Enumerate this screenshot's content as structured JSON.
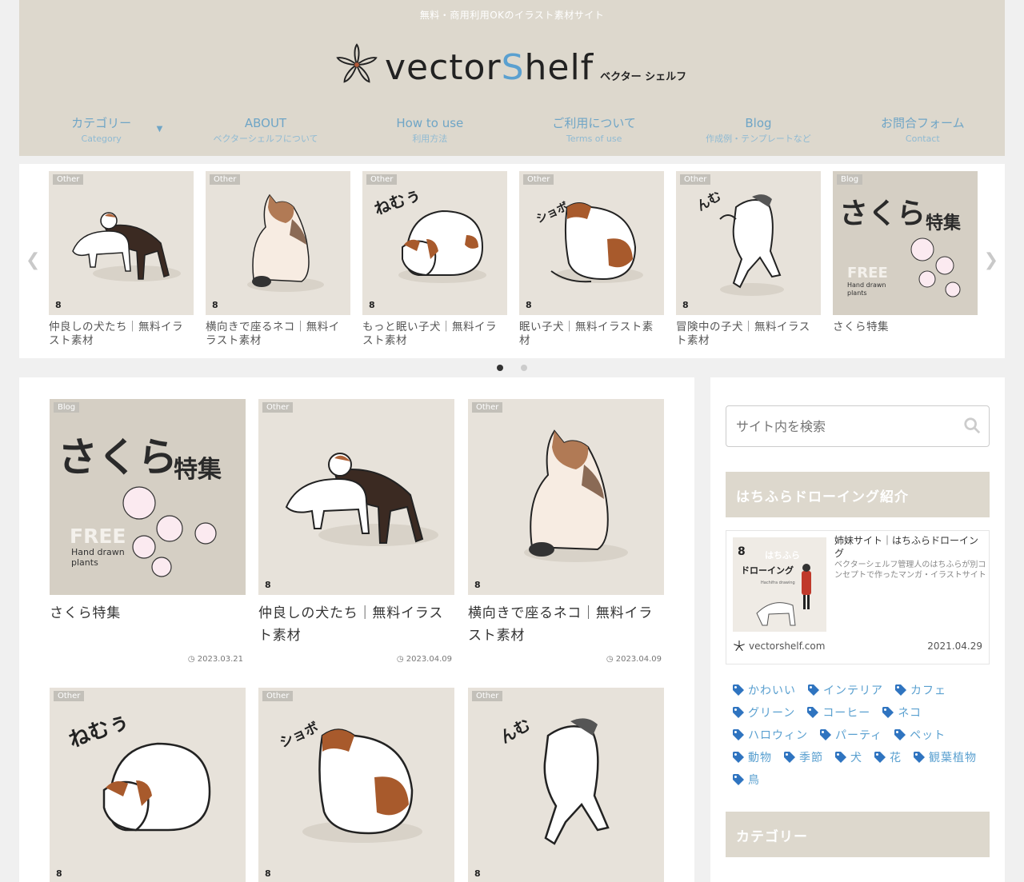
{
  "header": {
    "tagline": "無料・商用利用OKのイラスト素材サイト",
    "logo_text_a": "vector",
    "logo_text_s": "S",
    "logo_text_b": "helf",
    "logo_sub": "ベクター シェルフ",
    "nav": [
      {
        "main": "カテゴリー",
        "sub": "Category"
      },
      {
        "main": "ABOUT",
        "sub": "ベクターシェルフについて"
      },
      {
        "main": "How to use",
        "sub": "利用方法"
      },
      {
        "main": "ご利用について",
        "sub": "Terms of use"
      },
      {
        "main": "Blog",
        "sub": "作成例・テンプレートなど"
      },
      {
        "main": "お問合フォーム",
        "sub": "Contact"
      }
    ]
  },
  "carousel": {
    "items": [
      {
        "badge": "Other",
        "title": "仲良しの犬たち｜無料イラスト素材"
      },
      {
        "badge": "Other",
        "title": "横向きで座るネコ｜無料イラスト素材"
      },
      {
        "badge": "Other",
        "title": "もっと眠い子犬｜無料イラスト素材"
      },
      {
        "badge": "Other",
        "title": "眠い子犬｜無料イラスト素材"
      },
      {
        "badge": "Other",
        "title": "冒険中の子犬｜無料イラスト素材"
      },
      {
        "badge": "Blog",
        "title": "さくら特集"
      }
    ]
  },
  "posts": [
    {
      "badge": "Blog",
      "title": "さくら特集",
      "date": "2023.03.21"
    },
    {
      "badge": "Other",
      "title": "仲良しの犬たち｜無料イラスト素材",
      "date": "2023.04.09"
    },
    {
      "badge": "Other",
      "title": "横向きで座るネコ｜無料イラスト素材",
      "date": "2023.04.09"
    },
    {
      "badge": "Other",
      "title": ""
    },
    {
      "badge": "Other",
      "title": ""
    },
    {
      "badge": "Other",
      "title": ""
    }
  ],
  "art_text": {
    "sleepy": "ねむぅ",
    "shobo": "ショボ",
    "nmu": "んむ",
    "sakura": "さくら",
    "tokushu": "特集",
    "free": "FREE",
    "hand": "Hand drawn",
    "plants": "plants",
    "brand": "8",
    "shelf": "vectorShelf"
  },
  "sidebar": {
    "search_placeholder": "サイト内を検索",
    "promo_heading": "はちふらドローイング紹介",
    "promo": {
      "title": "姉妹サイト｜はちふらドローイング",
      "desc": "ベクターシェルフ管理人のはちふらが別コンセプトで作ったマンガ・イラストサイト",
      "thumb_title_a": "はちふら",
      "thumb_title_b": "ドローイング",
      "thumb_sub": "Hachifra drawing",
      "site": "vectorshelf.com",
      "date": "2021.04.29"
    },
    "tags": [
      "かわいい",
      "インテリア",
      "カフェ",
      "グリーン",
      "コーヒー",
      "ネコ",
      "ハロウィン",
      "パーティ",
      "ペット",
      "動物",
      "季節",
      "犬",
      "花",
      "観葉植物",
      "鳥"
    ],
    "category_heading": "カテゴリー"
  },
  "colors": {
    "accent": "#5aa0d0",
    "header_bg": "#ddd8cd",
    "thumb_bg": "#e7e2da"
  }
}
